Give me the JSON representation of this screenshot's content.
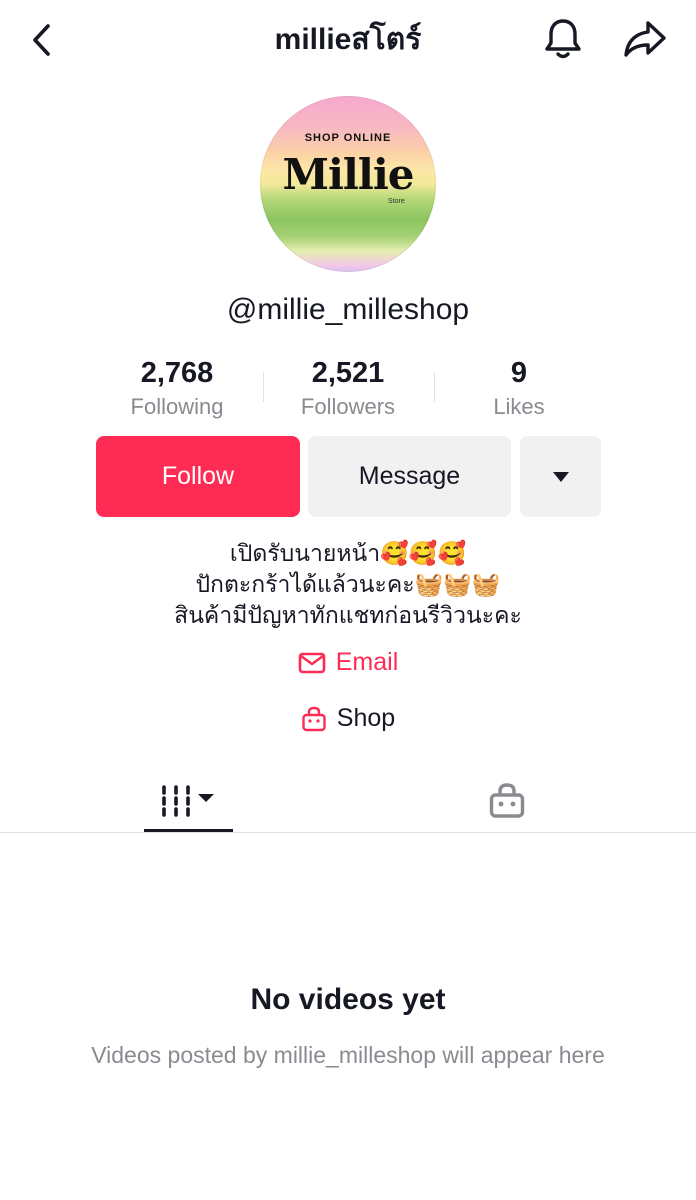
{
  "header": {
    "title": "millieสโตร์",
    "back_icon": "chevron-left-icon",
    "bell_icon": "bell-icon",
    "share_icon": "share-arrow-icon"
  },
  "avatar": {
    "top_text": "SHOP ONLINE",
    "name_text": "Millie",
    "sub_text": "Store"
  },
  "username": "@millie_milleshop",
  "stats": [
    {
      "value": "2,768",
      "label": "Following"
    },
    {
      "value": "2,521",
      "label": "Followers"
    },
    {
      "value": "9",
      "label": "Likes"
    }
  ],
  "actions": {
    "follow_label": "Follow",
    "message_label": "Message",
    "more_icon": "caret-down-icon"
  },
  "bio": {
    "lines": [
      "เปิดรับนายหน้า🥰🥰🥰",
      "ปักตะกร้าได้แล้วนะคะ🧺🧺🧺",
      "สินค้ามีปัญหาทักแชทก่อนรีวิวนะคะ"
    ]
  },
  "links": {
    "email_label": "Email",
    "shop_label": "Shop"
  },
  "tabs": {
    "videos_icon": "grid-columns-icon",
    "shop_icon": "shopping-bag-icon"
  },
  "empty_state": {
    "title": "No videos yet",
    "description": "Videos posted by millie_milleshop will appear here"
  },
  "colors": {
    "accent": "#fe2c55",
    "text": "#161823",
    "muted": "#8a8b91",
    "button_bg": "#f1f1f2"
  }
}
